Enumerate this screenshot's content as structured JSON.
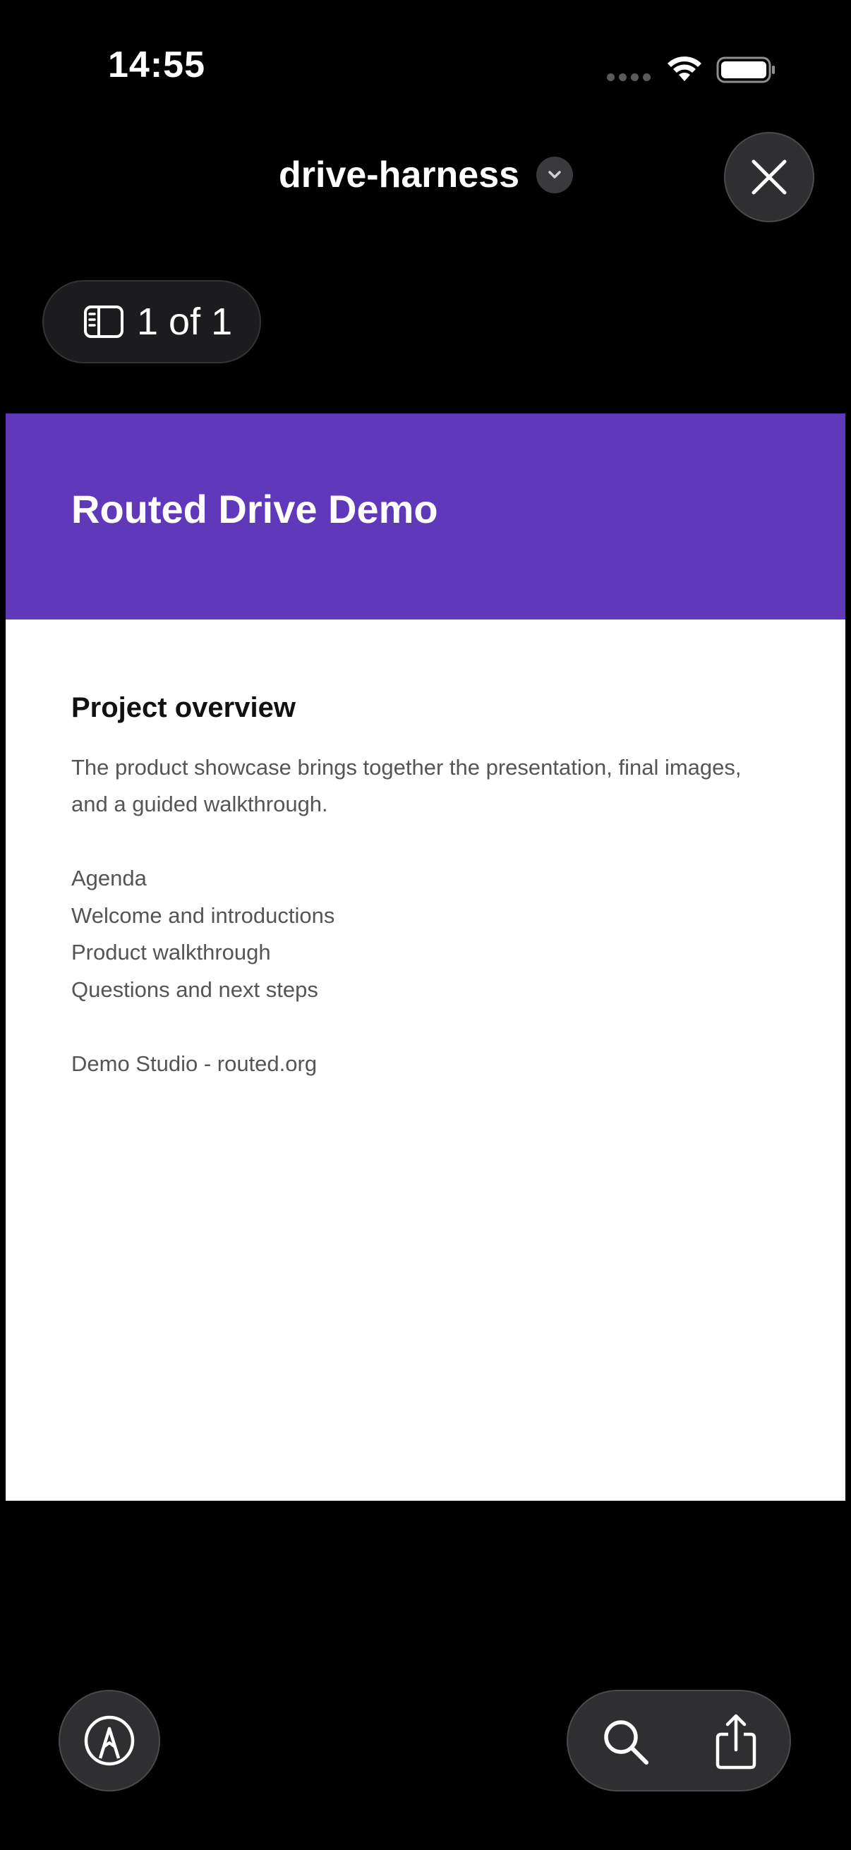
{
  "status_bar": {
    "time": "14:55"
  },
  "header": {
    "title": "drive-harness",
    "chevron_icon": "chevron-down-icon",
    "close_icon": "close-icon"
  },
  "page_indicator": {
    "icon": "sidebar-icon",
    "label": "1 of 1"
  },
  "document": {
    "banner_color": "#6039bb",
    "banner_title": "Routed Drive Demo",
    "section_heading": "Project overview",
    "paragraph_line_1": "The product showcase brings together the presentation, final images,",
    "paragraph_line_2": "and a guided walkthrough.",
    "agenda": [
      "Agenda",
      "Welcome and introductions",
      "Product walkthrough",
      "Questions and next steps"
    ],
    "footer": "Demo Studio - routed.org"
  },
  "toolbar": {
    "markup_icon": "markup-pen-icon",
    "search_icon": "search-icon",
    "share_icon": "share-icon"
  }
}
